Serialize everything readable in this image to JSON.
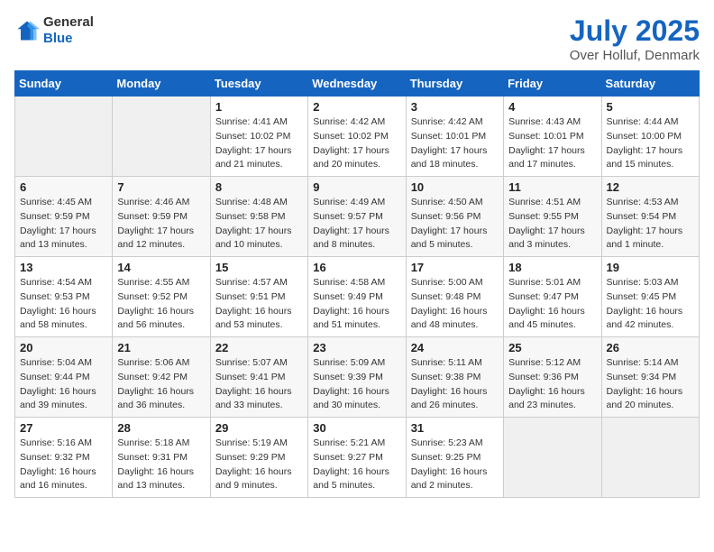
{
  "header": {
    "logo_general": "General",
    "logo_blue": "Blue",
    "title": "July 2025",
    "subtitle": "Over Holluf, Denmark"
  },
  "days_of_week": [
    "Sunday",
    "Monday",
    "Tuesday",
    "Wednesday",
    "Thursday",
    "Friday",
    "Saturday"
  ],
  "weeks": [
    [
      {
        "day": "",
        "sunrise": "",
        "sunset": "",
        "daylight": ""
      },
      {
        "day": "",
        "sunrise": "",
        "sunset": "",
        "daylight": ""
      },
      {
        "day": "1",
        "sunrise": "Sunrise: 4:41 AM",
        "sunset": "Sunset: 10:02 PM",
        "daylight": "Daylight: 17 hours and 21 minutes."
      },
      {
        "day": "2",
        "sunrise": "Sunrise: 4:42 AM",
        "sunset": "Sunset: 10:02 PM",
        "daylight": "Daylight: 17 hours and 20 minutes."
      },
      {
        "day": "3",
        "sunrise": "Sunrise: 4:42 AM",
        "sunset": "Sunset: 10:01 PM",
        "daylight": "Daylight: 17 hours and 18 minutes."
      },
      {
        "day": "4",
        "sunrise": "Sunrise: 4:43 AM",
        "sunset": "Sunset: 10:01 PM",
        "daylight": "Daylight: 17 hours and 17 minutes."
      },
      {
        "day": "5",
        "sunrise": "Sunrise: 4:44 AM",
        "sunset": "Sunset: 10:00 PM",
        "daylight": "Daylight: 17 hours and 15 minutes."
      }
    ],
    [
      {
        "day": "6",
        "sunrise": "Sunrise: 4:45 AM",
        "sunset": "Sunset: 9:59 PM",
        "daylight": "Daylight: 17 hours and 13 minutes."
      },
      {
        "day": "7",
        "sunrise": "Sunrise: 4:46 AM",
        "sunset": "Sunset: 9:59 PM",
        "daylight": "Daylight: 17 hours and 12 minutes."
      },
      {
        "day": "8",
        "sunrise": "Sunrise: 4:48 AM",
        "sunset": "Sunset: 9:58 PM",
        "daylight": "Daylight: 17 hours and 10 minutes."
      },
      {
        "day": "9",
        "sunrise": "Sunrise: 4:49 AM",
        "sunset": "Sunset: 9:57 PM",
        "daylight": "Daylight: 17 hours and 8 minutes."
      },
      {
        "day": "10",
        "sunrise": "Sunrise: 4:50 AM",
        "sunset": "Sunset: 9:56 PM",
        "daylight": "Daylight: 17 hours and 5 minutes."
      },
      {
        "day": "11",
        "sunrise": "Sunrise: 4:51 AM",
        "sunset": "Sunset: 9:55 PM",
        "daylight": "Daylight: 17 hours and 3 minutes."
      },
      {
        "day": "12",
        "sunrise": "Sunrise: 4:53 AM",
        "sunset": "Sunset: 9:54 PM",
        "daylight": "Daylight: 17 hours and 1 minute."
      }
    ],
    [
      {
        "day": "13",
        "sunrise": "Sunrise: 4:54 AM",
        "sunset": "Sunset: 9:53 PM",
        "daylight": "Daylight: 16 hours and 58 minutes."
      },
      {
        "day": "14",
        "sunrise": "Sunrise: 4:55 AM",
        "sunset": "Sunset: 9:52 PM",
        "daylight": "Daylight: 16 hours and 56 minutes."
      },
      {
        "day": "15",
        "sunrise": "Sunrise: 4:57 AM",
        "sunset": "Sunset: 9:51 PM",
        "daylight": "Daylight: 16 hours and 53 minutes."
      },
      {
        "day": "16",
        "sunrise": "Sunrise: 4:58 AM",
        "sunset": "Sunset: 9:49 PM",
        "daylight": "Daylight: 16 hours and 51 minutes."
      },
      {
        "day": "17",
        "sunrise": "Sunrise: 5:00 AM",
        "sunset": "Sunset: 9:48 PM",
        "daylight": "Daylight: 16 hours and 48 minutes."
      },
      {
        "day": "18",
        "sunrise": "Sunrise: 5:01 AM",
        "sunset": "Sunset: 9:47 PM",
        "daylight": "Daylight: 16 hours and 45 minutes."
      },
      {
        "day": "19",
        "sunrise": "Sunrise: 5:03 AM",
        "sunset": "Sunset: 9:45 PM",
        "daylight": "Daylight: 16 hours and 42 minutes."
      }
    ],
    [
      {
        "day": "20",
        "sunrise": "Sunrise: 5:04 AM",
        "sunset": "Sunset: 9:44 PM",
        "daylight": "Daylight: 16 hours and 39 minutes."
      },
      {
        "day": "21",
        "sunrise": "Sunrise: 5:06 AM",
        "sunset": "Sunset: 9:42 PM",
        "daylight": "Daylight: 16 hours and 36 minutes."
      },
      {
        "day": "22",
        "sunrise": "Sunrise: 5:07 AM",
        "sunset": "Sunset: 9:41 PM",
        "daylight": "Daylight: 16 hours and 33 minutes."
      },
      {
        "day": "23",
        "sunrise": "Sunrise: 5:09 AM",
        "sunset": "Sunset: 9:39 PM",
        "daylight": "Daylight: 16 hours and 30 minutes."
      },
      {
        "day": "24",
        "sunrise": "Sunrise: 5:11 AM",
        "sunset": "Sunset: 9:38 PM",
        "daylight": "Daylight: 16 hours and 26 minutes."
      },
      {
        "day": "25",
        "sunrise": "Sunrise: 5:12 AM",
        "sunset": "Sunset: 9:36 PM",
        "daylight": "Daylight: 16 hours and 23 minutes."
      },
      {
        "day": "26",
        "sunrise": "Sunrise: 5:14 AM",
        "sunset": "Sunset: 9:34 PM",
        "daylight": "Daylight: 16 hours and 20 minutes."
      }
    ],
    [
      {
        "day": "27",
        "sunrise": "Sunrise: 5:16 AM",
        "sunset": "Sunset: 9:32 PM",
        "daylight": "Daylight: 16 hours and 16 minutes."
      },
      {
        "day": "28",
        "sunrise": "Sunrise: 5:18 AM",
        "sunset": "Sunset: 9:31 PM",
        "daylight": "Daylight: 16 hours and 13 minutes."
      },
      {
        "day": "29",
        "sunrise": "Sunrise: 5:19 AM",
        "sunset": "Sunset: 9:29 PM",
        "daylight": "Daylight: 16 hours and 9 minutes."
      },
      {
        "day": "30",
        "sunrise": "Sunrise: 5:21 AM",
        "sunset": "Sunset: 9:27 PM",
        "daylight": "Daylight: 16 hours and 5 minutes."
      },
      {
        "day": "31",
        "sunrise": "Sunrise: 5:23 AM",
        "sunset": "Sunset: 9:25 PM",
        "daylight": "Daylight: 16 hours and 2 minutes."
      },
      {
        "day": "",
        "sunrise": "",
        "sunset": "",
        "daylight": ""
      },
      {
        "day": "",
        "sunrise": "",
        "sunset": "",
        "daylight": ""
      }
    ]
  ]
}
